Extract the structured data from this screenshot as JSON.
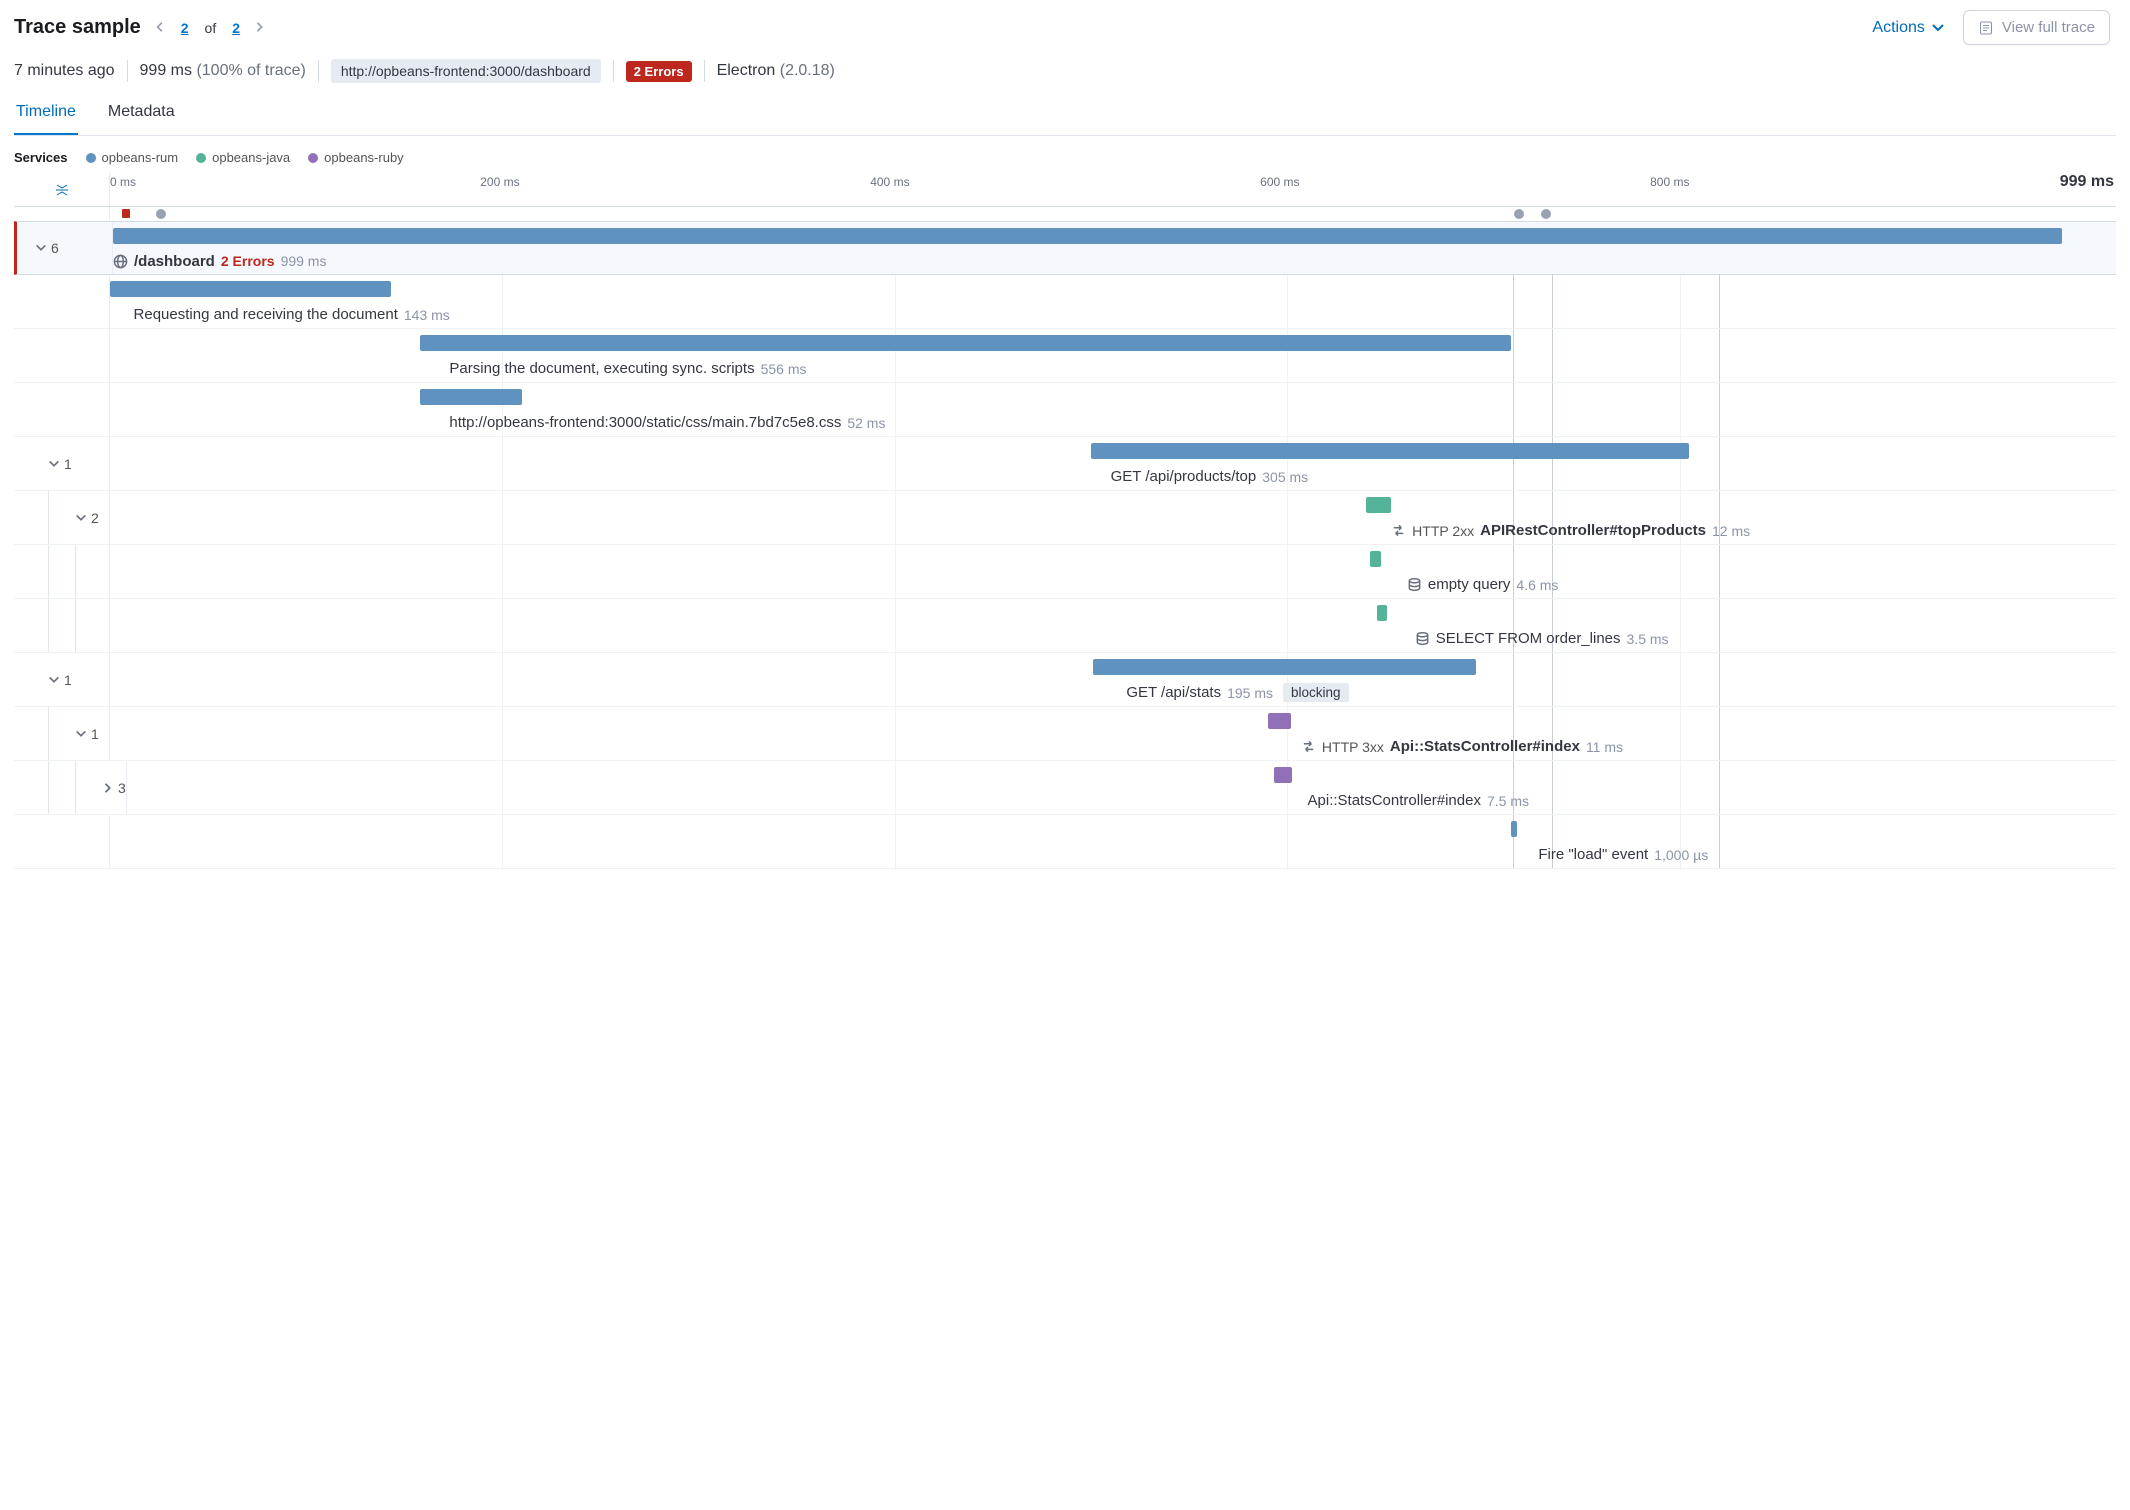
{
  "header": {
    "title": "Trace sample",
    "page_current": "2",
    "page_of_label": "of",
    "page_total": "2",
    "actions_label": "Actions",
    "view_full_label": "View full trace"
  },
  "meta": {
    "time_ago": "7 minutes ago",
    "duration": "999 ms",
    "duration_pct": "(100% of trace)",
    "url_badge": "http://opbeans-frontend:3000/dashboard",
    "error_badge": "2 Errors",
    "agent_name": "Electron",
    "agent_version": "(2.0.18)"
  },
  "tabs": {
    "timeline": "Timeline",
    "metadata": "Metadata"
  },
  "services_label": "Services",
  "services": [
    {
      "name": "opbeans-rum",
      "color": "#6092c0"
    },
    {
      "name": "opbeans-java",
      "color": "#54b399"
    },
    {
      "name": "opbeans-ruby",
      "color": "#9170b8"
    }
  ],
  "ruler": {
    "ticks": [
      "0 ms",
      "200 ms",
      "400 ms",
      "600 ms",
      "800 ms"
    ],
    "total": "999 ms"
  },
  "minimap": {
    "error_marker_pct": 0.8,
    "gray_markers_pct": [
      2.6,
      71.8,
      73.2
    ]
  },
  "feature_lines_pct": [
    71.5,
    73.5,
    82.0
  ],
  "chart_data": {
    "type": "table",
    "title": "Trace waterfall",
    "xlabel": "ms",
    "xlim": [
      0,
      999
    ],
    "rows": [
      {
        "name": "/dashboard",
        "service": "opbeans-rum",
        "start_ms": 0,
        "duration_ms": 999,
        "children": 6,
        "errors": 2,
        "icon": "globe"
      },
      {
        "name": "Requesting and receiving the document",
        "service": "opbeans-rum",
        "start_ms": 0,
        "duration_ms": 143
      },
      {
        "name": "Parsing the document, executing sync. scripts",
        "service": "opbeans-rum",
        "start_ms": 158,
        "duration_ms": 556
      },
      {
        "name": "http://opbeans-frontend:3000/static/css/main.7bd7c5e8.css",
        "service": "opbeans-rum",
        "start_ms": 158,
        "duration_ms": 52
      },
      {
        "name": "GET /api/products/top",
        "service": "opbeans-rum",
        "start_ms": 500,
        "duration_ms": 305,
        "children": 1
      },
      {
        "name": "APIRestController#topProducts",
        "service": "opbeans-java",
        "start_ms": 640,
        "duration_ms": 12,
        "children": 2,
        "prefix": "HTTP 2xx",
        "icon": "transaction"
      },
      {
        "name": "empty query",
        "service": "opbeans-java",
        "start_ms": 642,
        "duration_ms": 4.6,
        "icon": "db"
      },
      {
        "name": "SELECT FROM order_lines",
        "service": "opbeans-java",
        "start_ms": 646,
        "duration_ms": 3.5,
        "icon": "db"
      },
      {
        "name": "GET /api/stats",
        "service": "opbeans-rum",
        "start_ms": 500,
        "duration_ms": 195,
        "children": 1,
        "tag": "blocking"
      },
      {
        "name": "Api::StatsController#index",
        "service": "opbeans-ruby",
        "start_ms": 590,
        "duration_ms": 11,
        "children": 1,
        "prefix": "HTTP 3xx",
        "icon": "transaction"
      },
      {
        "name": "Api::StatsController#index",
        "service": "opbeans-ruby",
        "start_ms": 590,
        "duration_ms": 7.5,
        "children": 3
      },
      {
        "name": "Fire \"load\" event",
        "service": "opbeans-rum",
        "start_ms": 714,
        "duration_label": "1,000 µs",
        "duration_ms": 1
      }
    ]
  },
  "rows": [
    {
      "id": "r0",
      "indent": 0,
      "expand_count": "6",
      "chev": "down",
      "service": "rum",
      "bar_left_pct": 0,
      "bar_width_pct": 99.5,
      "icon": "globe",
      "name_bold": true,
      "name": "/dashboard",
      "errors": "2 Errors",
      "duration": "999 ms",
      "label_left_pct": 0,
      "first_row": true
    },
    {
      "id": "r1",
      "indent": 1,
      "chev": "",
      "service": "rum",
      "bar_left_pct": 0,
      "bar_width_pct": 14.3,
      "name": "Requesting and receiving the document",
      "duration": "143 ms",
      "label_left_pct": 1.2
    },
    {
      "id": "r2",
      "indent": 1,
      "chev": "",
      "service": "rum",
      "bar_left_pct": 15.8,
      "bar_width_pct": 55.6,
      "name": "Parsing the document, executing sync. scripts",
      "duration": "556 ms",
      "label_left_pct": 17.3
    },
    {
      "id": "r3",
      "indent": 1,
      "chev": "",
      "service": "rum",
      "bar_left_pct": 15.8,
      "bar_width_pct": 5.2,
      "name": "http://opbeans-frontend:3000/static/css/main.7bd7c5e8.css",
      "duration": "52 ms",
      "label_left_pct": 17.3
    },
    {
      "id": "r4",
      "indent": 1,
      "expand_count": "1",
      "chev": "down",
      "service": "rum",
      "bar_left_pct": 50.0,
      "bar_width_pct": 30.5,
      "name": "GET /api/products/top",
      "duration": "305 ms",
      "label_left_pct": 51.0
    },
    {
      "id": "r5",
      "indent": 2,
      "expand_count": "2",
      "chev": "down",
      "service": "java",
      "bar_left_pct": 64.0,
      "bar_width_pct": 1.3,
      "icon": "transaction",
      "prefix": "HTTP 2xx",
      "name_bold": true,
      "name": "APIRestController#topProducts",
      "duration": "12 ms",
      "label_left_pct": 65.3
    },
    {
      "id": "r6",
      "indent": 3,
      "chev": "",
      "service": "java",
      "bar_left_pct": 64.2,
      "bar_width_pct": 0.6,
      "icon": "db",
      "name": "empty query",
      "duration": "4.6 ms",
      "label_left_pct": 66.1
    },
    {
      "id": "r7",
      "indent": 3,
      "chev": "",
      "service": "java",
      "bar_left_pct": 64.6,
      "bar_width_pct": 0.5,
      "icon": "db",
      "name": "SELECT FROM order_lines",
      "duration": "3.5 ms",
      "label_left_pct": 66.5
    },
    {
      "id": "r8",
      "indent": 1,
      "expand_count": "1",
      "chev": "down",
      "service": "rum",
      "bar_left_pct": 50.1,
      "bar_width_pct": 19.5,
      "name": "GET /api/stats",
      "duration": "195 ms",
      "tag": "blocking",
      "label_left_pct": 51.8
    },
    {
      "id": "r9",
      "indent": 2,
      "expand_count": "1",
      "chev": "down",
      "service": "ruby",
      "bar_left_pct": 59.0,
      "bar_width_pct": 1.2,
      "icon": "transaction",
      "prefix": "HTTP 3xx",
      "name_bold": true,
      "name": "Api::StatsController#index",
      "duration": "11 ms",
      "label_left_pct": 60.7
    },
    {
      "id": "r10",
      "indent": 3,
      "expand_count": "3",
      "chev": "right",
      "service": "ruby",
      "bar_left_pct": 59.0,
      "bar_width_pct": 0.9,
      "name": "Api::StatsController#index",
      "duration": "7.5 ms",
      "label_left_pct": 60.7
    },
    {
      "id": "r11",
      "indent": 1,
      "chev": "",
      "service": "rum",
      "bar_left_pct": 71.4,
      "bar_width_pct": 0.3,
      "name": "Fire \"load\" event",
      "duration": "1,000 µs",
      "label_left_pct": 72.8
    }
  ]
}
